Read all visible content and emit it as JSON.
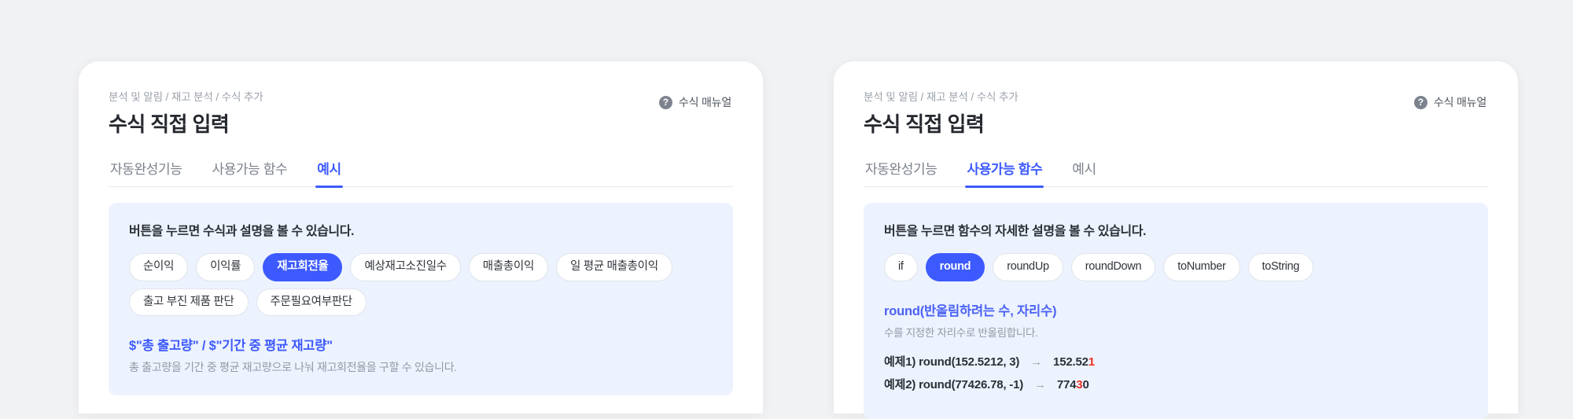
{
  "theme": {
    "accent": "#3d5afe",
    "panel_bg": "#edf3fe",
    "page_bg": "#f1f2f4",
    "highlight": "#ef3124",
    "muted_text": "#9299a5"
  },
  "panels": [
    {
      "breadcrumb": "분석 및 알림 / 재고 분석 / 수식 추가",
      "title": "수식 직접 입력",
      "manual_link": {
        "label": "수식 매뉴얼",
        "icon": "question-circle-icon",
        "glyph": "?"
      },
      "tabs": [
        {
          "label": "자동완성기능",
          "active": false
        },
        {
          "label": "사용가능 함수",
          "active": false
        },
        {
          "label": "예시",
          "active": true
        }
      ],
      "panel_heading": "버튼을 누르면 수식과 설명을 볼 수 있습니다.",
      "chips": [
        {
          "label": "순이익",
          "active": false
        },
        {
          "label": "이익률",
          "active": false
        },
        {
          "label": "재고회전율",
          "active": true
        },
        {
          "label": "예상재고소진일수",
          "active": false
        },
        {
          "label": "매출총이익",
          "active": false
        },
        {
          "label": "일 평균 매출총이익",
          "active": false
        },
        {
          "label": "출고 부진 제품 판단",
          "active": false
        },
        {
          "label": "주문필요여부판단",
          "active": false
        }
      ],
      "detail": {
        "kind": "formula",
        "formula": "$\"총 출고량\" / $\"기간 중 평균 재고량\"",
        "description": "총 출고량을 기간 중 평균 재고량으로 나눠 재고회전율을 구할 수 있습니다."
      }
    },
    {
      "breadcrumb": "분석 및 알림 / 재고 분석 / 수식 추가",
      "title": "수식 직접 입력",
      "manual_link": {
        "label": "수식 매뉴얼",
        "icon": "question-circle-icon",
        "glyph": "?"
      },
      "tabs": [
        {
          "label": "자동완성기능",
          "active": false
        },
        {
          "label": "사용가능 함수",
          "active": true
        },
        {
          "label": "예시",
          "active": false
        }
      ],
      "panel_heading": "버튼을 누르면 함수의 자세한 설명을 볼 수 있습니다.",
      "chips": [
        {
          "label": "if",
          "active": false
        },
        {
          "label": "round",
          "active": true
        },
        {
          "label": "roundUp",
          "active": false
        },
        {
          "label": "roundDown",
          "active": false
        },
        {
          "label": "toNumber",
          "active": false
        },
        {
          "label": "toString",
          "active": false
        }
      ],
      "detail": {
        "kind": "function",
        "signature": "round(반올림하려는 수, 자리수)",
        "description": "수를 지정한 자리수로 반올림합니다.",
        "examples": [
          {
            "call": "예제1) round(152.5212, 3)",
            "arrow": "→",
            "result_plain": "152.52",
            "result_highlight": "1",
            "result_tail": ""
          },
          {
            "call": "예제2) round(77426.78, -1)",
            "arrow": "→",
            "result_plain": "774",
            "result_highlight": "3",
            "result_tail": "0"
          }
        ]
      }
    }
  ]
}
